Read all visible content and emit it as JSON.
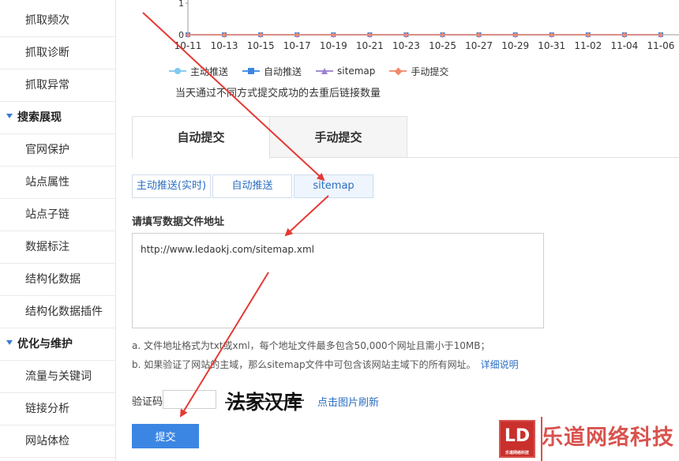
{
  "sidebar": {
    "items": [
      {
        "type": "item",
        "label": "抓取频次"
      },
      {
        "type": "item",
        "label": "抓取诊断"
      },
      {
        "type": "item",
        "label": "抓取异常"
      },
      {
        "type": "group",
        "label": "搜索展现"
      },
      {
        "type": "item",
        "label": "官网保护"
      },
      {
        "type": "item",
        "label": "站点属性"
      },
      {
        "type": "item",
        "label": "站点子链"
      },
      {
        "type": "item",
        "label": "数据标注"
      },
      {
        "type": "item",
        "label": "结构化数据"
      },
      {
        "type": "item",
        "label": "结构化数据插件"
      },
      {
        "type": "group",
        "label": "优化与维护"
      },
      {
        "type": "item",
        "label": "流量与关键词"
      },
      {
        "type": "item",
        "label": "链接分析"
      },
      {
        "type": "item",
        "label": "网站体检"
      }
    ]
  },
  "chart_data": {
    "type": "line",
    "categories": [
      "10-11",
      "10-13",
      "10-15",
      "10-17",
      "10-19",
      "10-21",
      "10-23",
      "10-25",
      "10-27",
      "10-29",
      "10-31",
      "11-02",
      "11-04",
      "11-06"
    ],
    "y_ticks": [
      "1",
      "0"
    ],
    "ylim": [
      0,
      1
    ],
    "series": [
      {
        "name": "主动推送",
        "color": "#7fc8ef",
        "marker": "circle",
        "values": [
          0,
          0,
          0,
          0,
          0,
          0,
          0,
          0,
          0,
          0,
          0,
          0,
          0,
          0
        ]
      },
      {
        "name": "自动推送",
        "color": "#3b86e3",
        "marker": "square",
        "values": [
          0,
          0,
          0,
          0,
          0,
          0,
          0,
          0,
          0,
          0,
          0,
          0,
          0,
          0
        ]
      },
      {
        "name": "sitemap",
        "color": "#9b7fd1",
        "marker": "triangle",
        "values": [
          0,
          0,
          0,
          0,
          0,
          0,
          0,
          0,
          0,
          0,
          0,
          0,
          0,
          0
        ]
      },
      {
        "name": "手动提交",
        "color": "#f08a6a",
        "marker": "diamond",
        "values": [
          0,
          0,
          0,
          0,
          0,
          0,
          0,
          0,
          0,
          0,
          0,
          0,
          0,
          0
        ]
      }
    ],
    "legend_position": "bottom",
    "note": "当天通过不同方式提交成功的去重后链接数量"
  },
  "tabs": {
    "big": [
      "自动提交",
      "手动提交"
    ],
    "sub": [
      "主动推送(实时)",
      "自动推送",
      "sitemap"
    ]
  },
  "form": {
    "label": "请填写数据文件地址",
    "url_value": "http://www.ledaokj.com/sitemap.xml",
    "note_a": "a. 文件地址格式为txt或xml，每个地址文件最多包含50,000个网址且需小于10MB；",
    "note_b": "b. 如果验证了网站的主域，那么sitemap文件中可包含该网站主域下的所有网址。",
    "note_b_link": "详细说明",
    "captcha_label": "验证码",
    "captcha_text": "法家汉库",
    "captcha_refresh": "点击图片刷新",
    "submit": "提交"
  },
  "watermark": {
    "logo": "LD",
    "logo_small": "乐道网络科技",
    "text": "乐道网络科技"
  },
  "colors": {
    "accent": "#3b86e3",
    "link": "#2b6fc2",
    "arrow": "#e53935"
  }
}
